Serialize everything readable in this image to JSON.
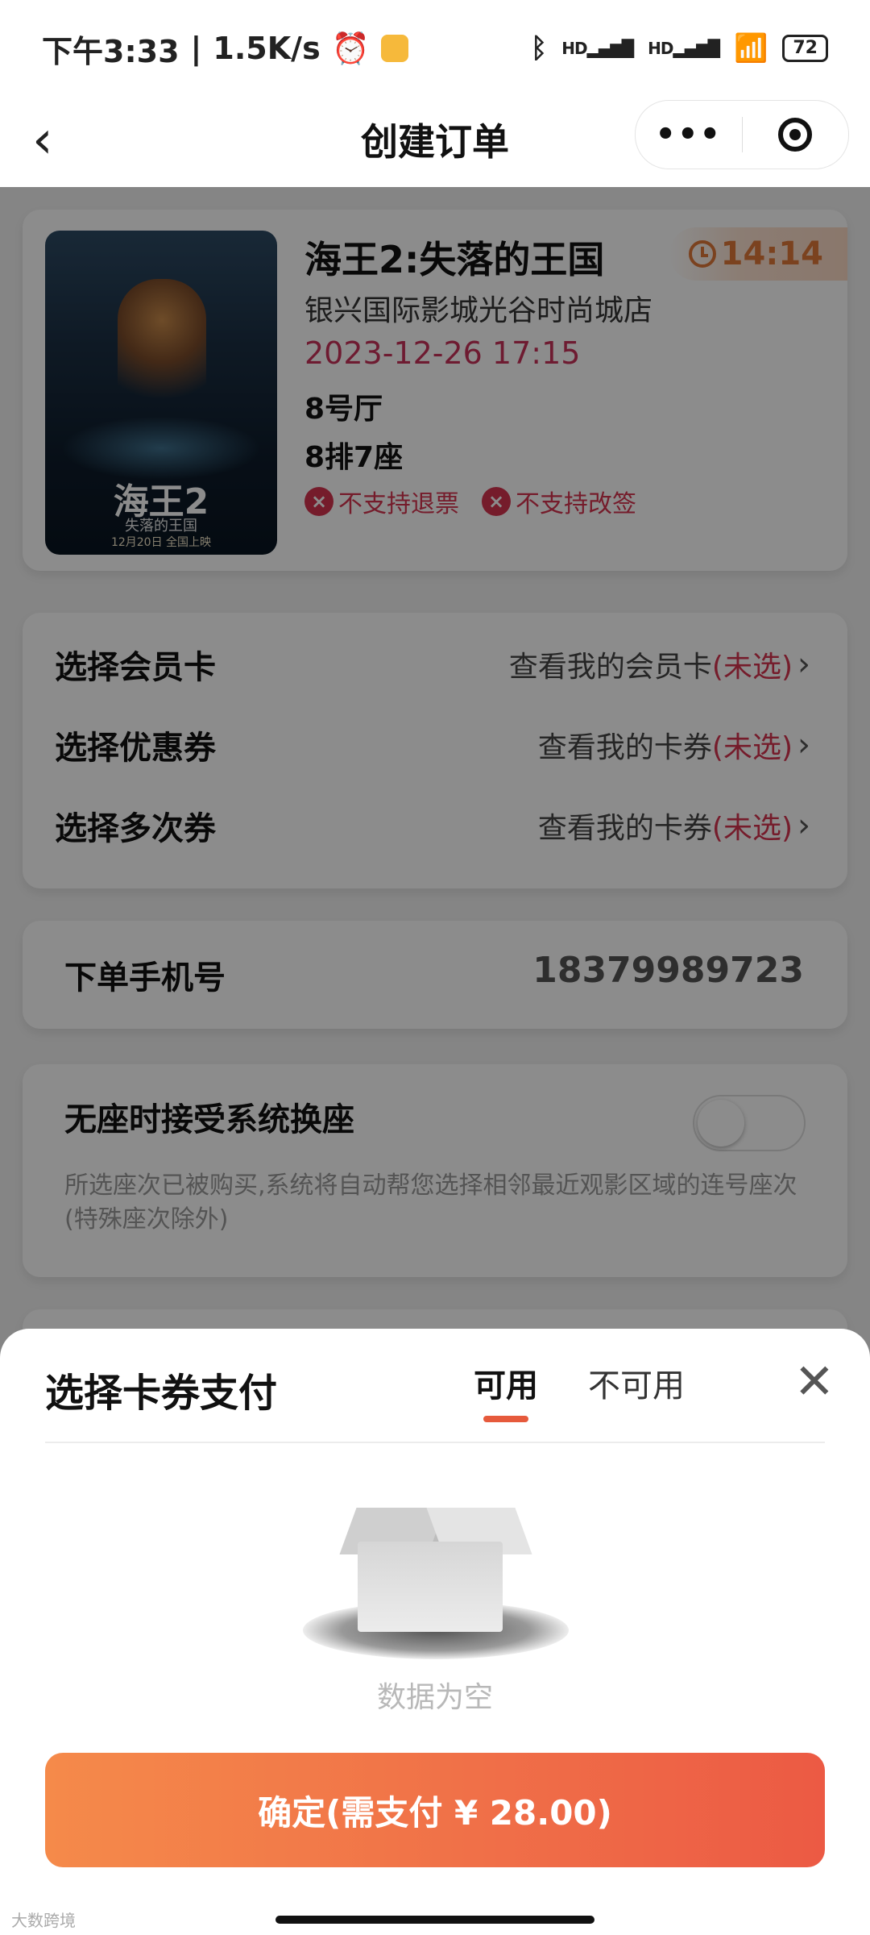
{
  "status_bar": {
    "time": "下午3:33",
    "speed": "1.5K/s",
    "alarm_icon": "alarm-clock-icon",
    "bluetooth_icon": "bluetooth-icon",
    "signal_label_1": "HD",
    "signal_label_2": "HD",
    "wifi_icon": "wifi-icon",
    "battery": "72"
  },
  "nav": {
    "back_icon": "‹",
    "title": "创建订单",
    "more_icon": "•••"
  },
  "movie": {
    "poster_title": "海王2",
    "poster_subtitle": "失落的王国",
    "poster_date": "12月20日 全国上映",
    "title": "海王2:失落的王国",
    "countdown": "14:14",
    "cinema": "银兴国际影城光谷时尚城店",
    "showtime": "2023-12-26 17:15",
    "hall": "8号厅",
    "seat": "8排7座",
    "tags": [
      "不支持退票",
      "不支持改签"
    ]
  },
  "options": [
    {
      "label": "选择会员卡",
      "value": "查看我的会员卡",
      "status": "(未选)"
    },
    {
      "label": "选择优惠券",
      "value": "查看我的卡券",
      "status": "(未选)"
    },
    {
      "label": "选择多次券",
      "value": "查看我的卡券",
      "status": "(未选)"
    }
  ],
  "phone": {
    "label": "下单手机号",
    "value": "18379989723"
  },
  "seat_change": {
    "title": "无座时接受系统换座",
    "enabled": false,
    "description": "所选座次已被购买,系统将自动帮您选择相邻最近观影区域的连号座次(特殊座次除外)"
  },
  "sheet": {
    "title": "选择卡券支付",
    "tabs": [
      "可用",
      "不可用"
    ],
    "active_tab": 0,
    "close_icon": "✕",
    "empty_text": "数据为空",
    "confirm_label": "确定(需支付 ¥ 28.00)"
  },
  "watermark": "大数跨境",
  "colors": {
    "accent": "#e65a3c",
    "warning_red": "#d6334f",
    "timer_orange": "#e0793a"
  }
}
